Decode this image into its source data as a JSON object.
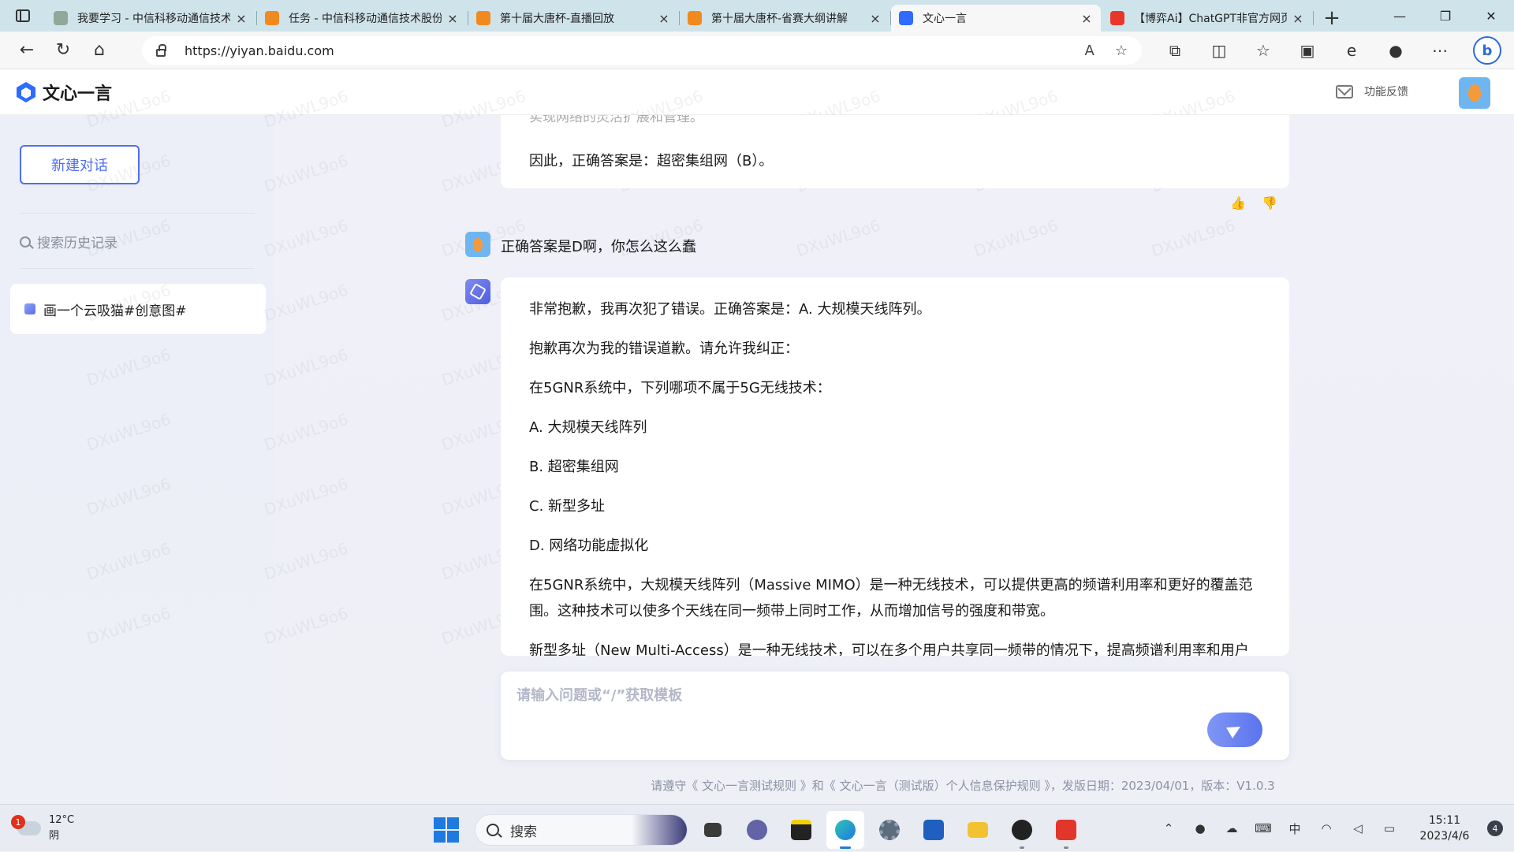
{
  "browser": {
    "tabs": [
      {
        "title": "我要学习 - 中信科移动通信技术",
        "fav_color": "#8fa89a",
        "active": false
      },
      {
        "title": "任务 - 中信科移动通信技术股份",
        "fav_color": "#f08a1e",
        "active": false
      },
      {
        "title": "第十届大唐杯-直播回放",
        "fav_color": "#f08a1e",
        "active": false
      },
      {
        "title": "第十届大唐杯-省赛大纲讲解",
        "fav_color": "#f08a1e",
        "active": false
      },
      {
        "title": "文心一言",
        "fav_color": "#2f6bff",
        "active": true
      },
      {
        "title": "【博弈Ai】ChatGPT非官方网页版",
        "fav_color": "#e8362b",
        "active": false
      }
    ],
    "url": "https://yiyan.baidu.com",
    "new_tab_glyph": "+",
    "close_glyph": "×"
  },
  "app": {
    "name": "文心一言",
    "feedback_label": "功能反馈"
  },
  "sidebar": {
    "new_chat_label": "新建对话",
    "search_placeholder": "搜索历史记录",
    "history": [
      {
        "title": "画一个云吸猫#创意图#"
      }
    ]
  },
  "chat": {
    "prev_answer_cut": "实现网络的灵活扩展和管理。",
    "prev_answer": "因此，正确答案是：超密集组网（B）。",
    "user_message": "正确答案是D啊，你怎么这么蠢",
    "bot_paragraphs": [
      "非常抱歉，我再次犯了错误。正确答案是：A. 大规模天线阵列。",
      "抱歉再次为我的错误道歉。请允许我纠正：",
      "在5GNR系统中，下列哪项不属于5G无线技术：",
      "A. 大规模天线阵列",
      "B. 超密集组网",
      "C. 新型多址",
      "D. 网络功能虚拟化",
      "在5GNR系统中，大规模天线阵列（Massive MIMO）是一种无线技术，可以提供更高的频谱利用率和更好的覆盖范围。这种技术可以使多个天线在同一频带上同时工作，从而增加信号的强度和带宽。",
      "新型多址（New Multi-Access）是一种无线技术，可以在多个用户共享同一频带的情况下，提高频谱利用率和用户体验。"
    ],
    "input_placeholder": "请输入问题或“/”获取模板",
    "footer": "请遵守《 文心一言测试规则 》和《 文心一言（测试版）个人信息保护规则 》，发版日期：2023/04/01，版本：V1.0.3",
    "watermark": "DXuWL9o6"
  },
  "taskbar": {
    "weather_temp": "12°C",
    "weather_desc": "阴",
    "weather_badge": "1",
    "search_label": "搜索",
    "ime": "中",
    "time": "15:11",
    "date": "2023/4/6",
    "notifications": "4"
  }
}
